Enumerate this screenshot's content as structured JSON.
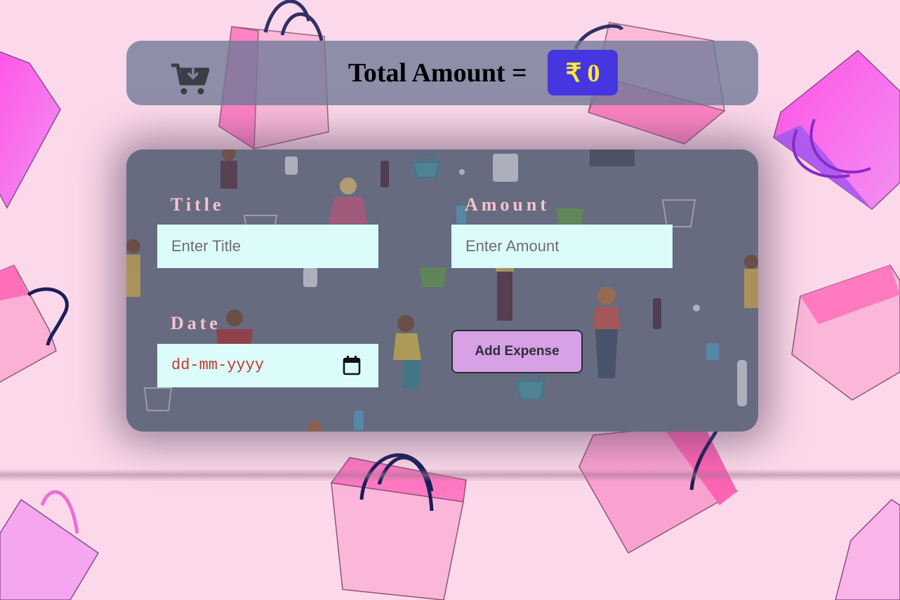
{
  "header": {
    "cart_icon": "cart-download-icon",
    "total_label": "Total Amount =",
    "currency_symbol": "₹",
    "total_value": "0"
  },
  "form": {
    "title_label": "Title",
    "title_placeholder": "Enter Title",
    "amount_label": "Amount",
    "amount_placeholder": "Enter Amount",
    "date_label": "Date",
    "date_placeholder": "dd-mm-yyyy",
    "calendar_icon": "calendar-icon",
    "add_button_label": "Add Expense"
  },
  "colors": {
    "page_background": "#fcd9ea",
    "header_bar": "#6e7896",
    "total_badge": "#4536e0",
    "total_text": "#ffe83a",
    "label_text": "#f7c2cf",
    "input_background": "#dcfbfb",
    "date_text": "#c23a2b",
    "button_background": "#d7a1e6"
  }
}
